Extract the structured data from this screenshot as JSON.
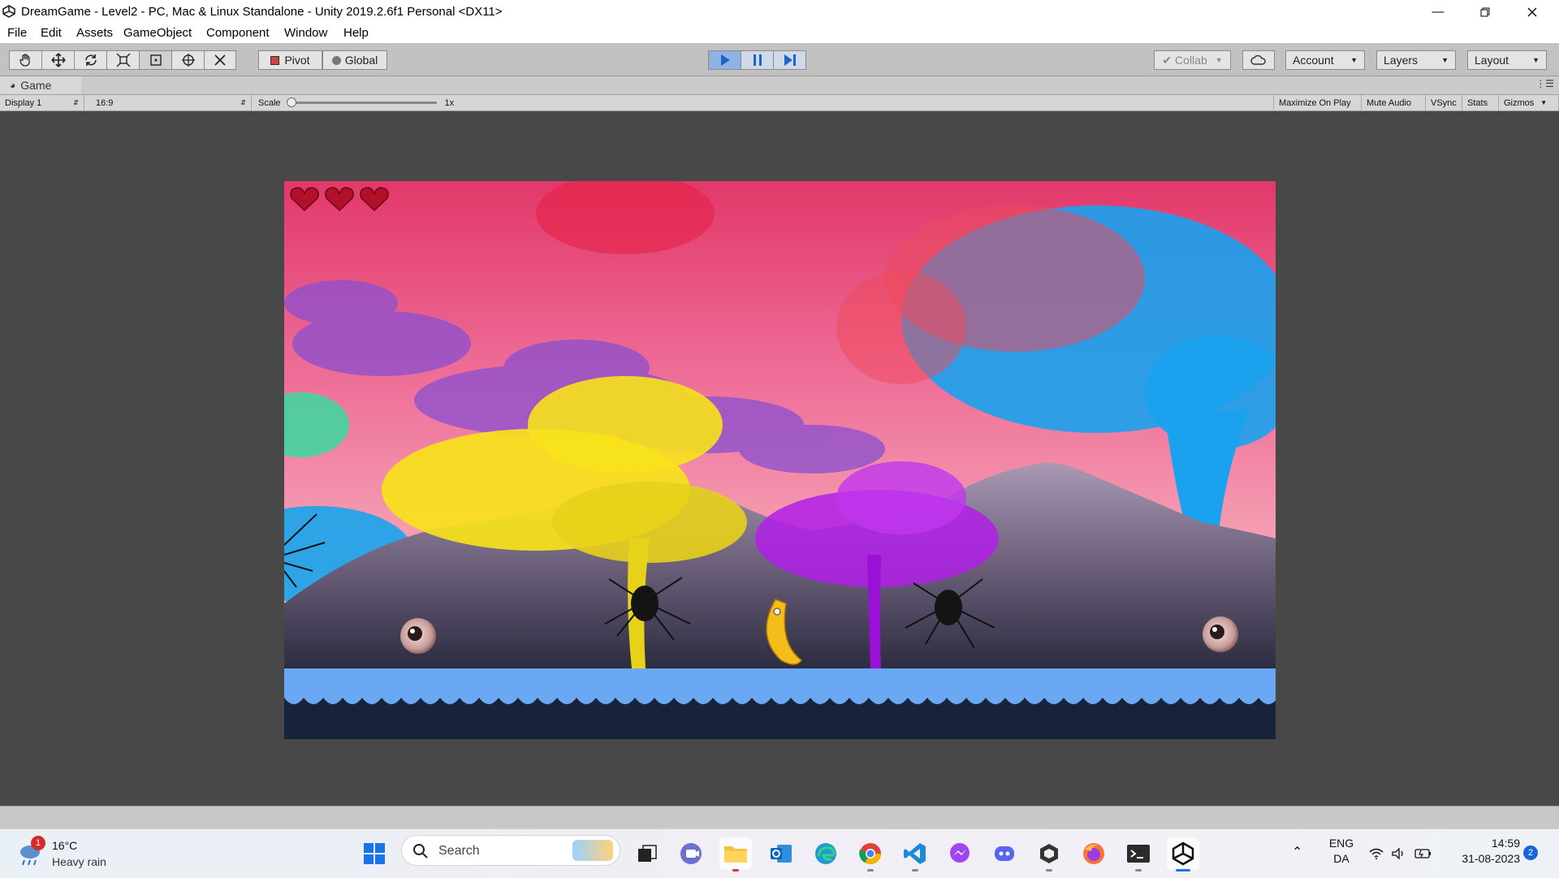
{
  "window": {
    "title": "DreamGame - Level2 - PC, Mac & Linux Standalone - Unity 2019.2.6f1 Personal <DX11>",
    "controls": [
      "minimize-icon",
      "restore-icon",
      "close-icon"
    ]
  },
  "menu": [
    "File",
    "Edit",
    "Assets",
    "GameObject",
    "Component",
    "Window",
    "Help"
  ],
  "toolbar": {
    "pivot": "Pivot",
    "global": "Global",
    "collab": "Collab",
    "account": "Account",
    "layers": "Layers",
    "layout": "Layout"
  },
  "game_panel": {
    "tab": "Game",
    "display": "Display 1",
    "aspect": "16:9",
    "scale_label": "Scale",
    "scale_value": "1x",
    "options": [
      "Maximize On Play",
      "Mute Audio",
      "VSync",
      "Stats",
      "Gizmos"
    ]
  },
  "game": {
    "hearts": 3,
    "colors": {
      "sky_top": "#e2386a",
      "sky_bottom": "#f6a8b8",
      "ground": "#6aa8f4",
      "mountains": "#7a6b86"
    }
  },
  "taskbar": {
    "weather_temp": "16°C",
    "weather_desc": "Heavy rain",
    "weather_badge": "1",
    "search_placeholder": "Search",
    "lang_top": "ENG",
    "lang_bottom": "DA",
    "time": "14:59",
    "date": "31-08-2023",
    "notif_count": "2",
    "apps": [
      "start-icon",
      "search-icon",
      "task-view-icon",
      "teams-icon",
      "file-explorer-icon",
      "outlook-icon",
      "edge-icon",
      "chrome-icon",
      "vscode-icon",
      "messenger-icon",
      "discord-icon",
      "unity-hub-icon",
      "firefox-icon",
      "terminal-icon",
      "unity-icon"
    ]
  }
}
